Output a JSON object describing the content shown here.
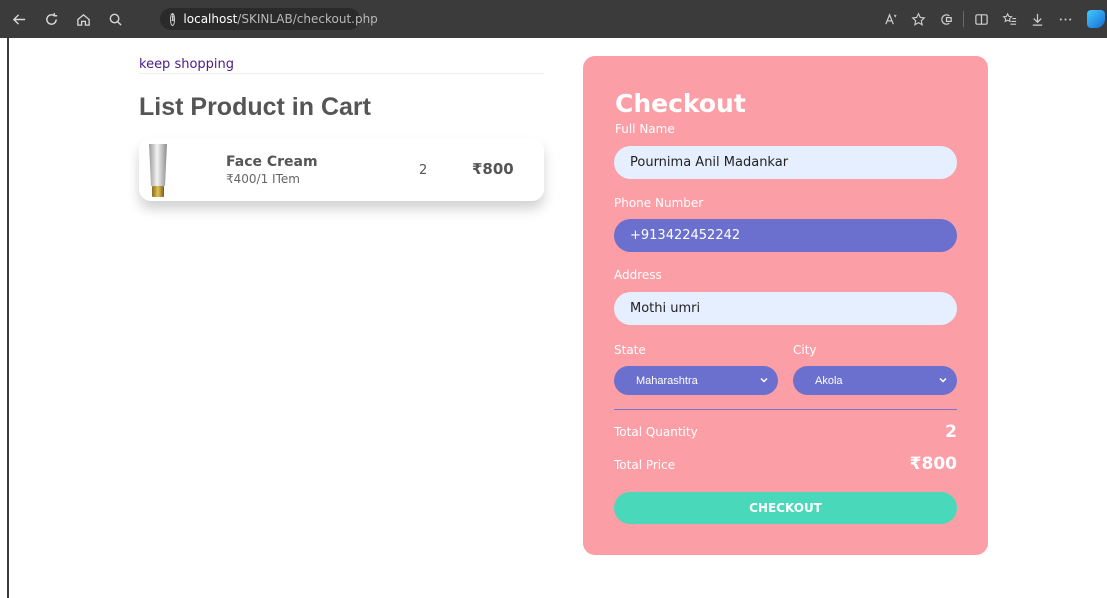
{
  "browser": {
    "url_host": "localhost",
    "url_path": "/SKINLAB/checkout.php"
  },
  "page": {
    "keep_shopping": "keep shopping",
    "cart_title": "List Product in Cart"
  },
  "cart": {
    "items": [
      {
        "name": "Face Cream",
        "unit_price": "₹400/1 ITem",
        "quantity": "2",
        "total": "₹800"
      }
    ]
  },
  "checkout": {
    "title": "Checkout",
    "full_name_label": "Full Name",
    "full_name_value": "Pournima Anil Madankar",
    "phone_label": "Phone Number",
    "phone_value": "+913422452242",
    "address_label": "Address",
    "address_value": "Mothi umri",
    "state_label": "State",
    "state_value": "Maharashtra",
    "city_label": "City",
    "city_value": "Akola",
    "total_quantity_label": "Total Quantity",
    "total_quantity_value": "2",
    "total_price_label": "Total Price",
    "total_price_value": "₹800",
    "button_label": "CHECKOUT"
  },
  "colors": {
    "panel": "#fc9ea5",
    "field_light": "#e6efff",
    "field_blue": "#6b6fcd",
    "button": "#49d8b9"
  }
}
